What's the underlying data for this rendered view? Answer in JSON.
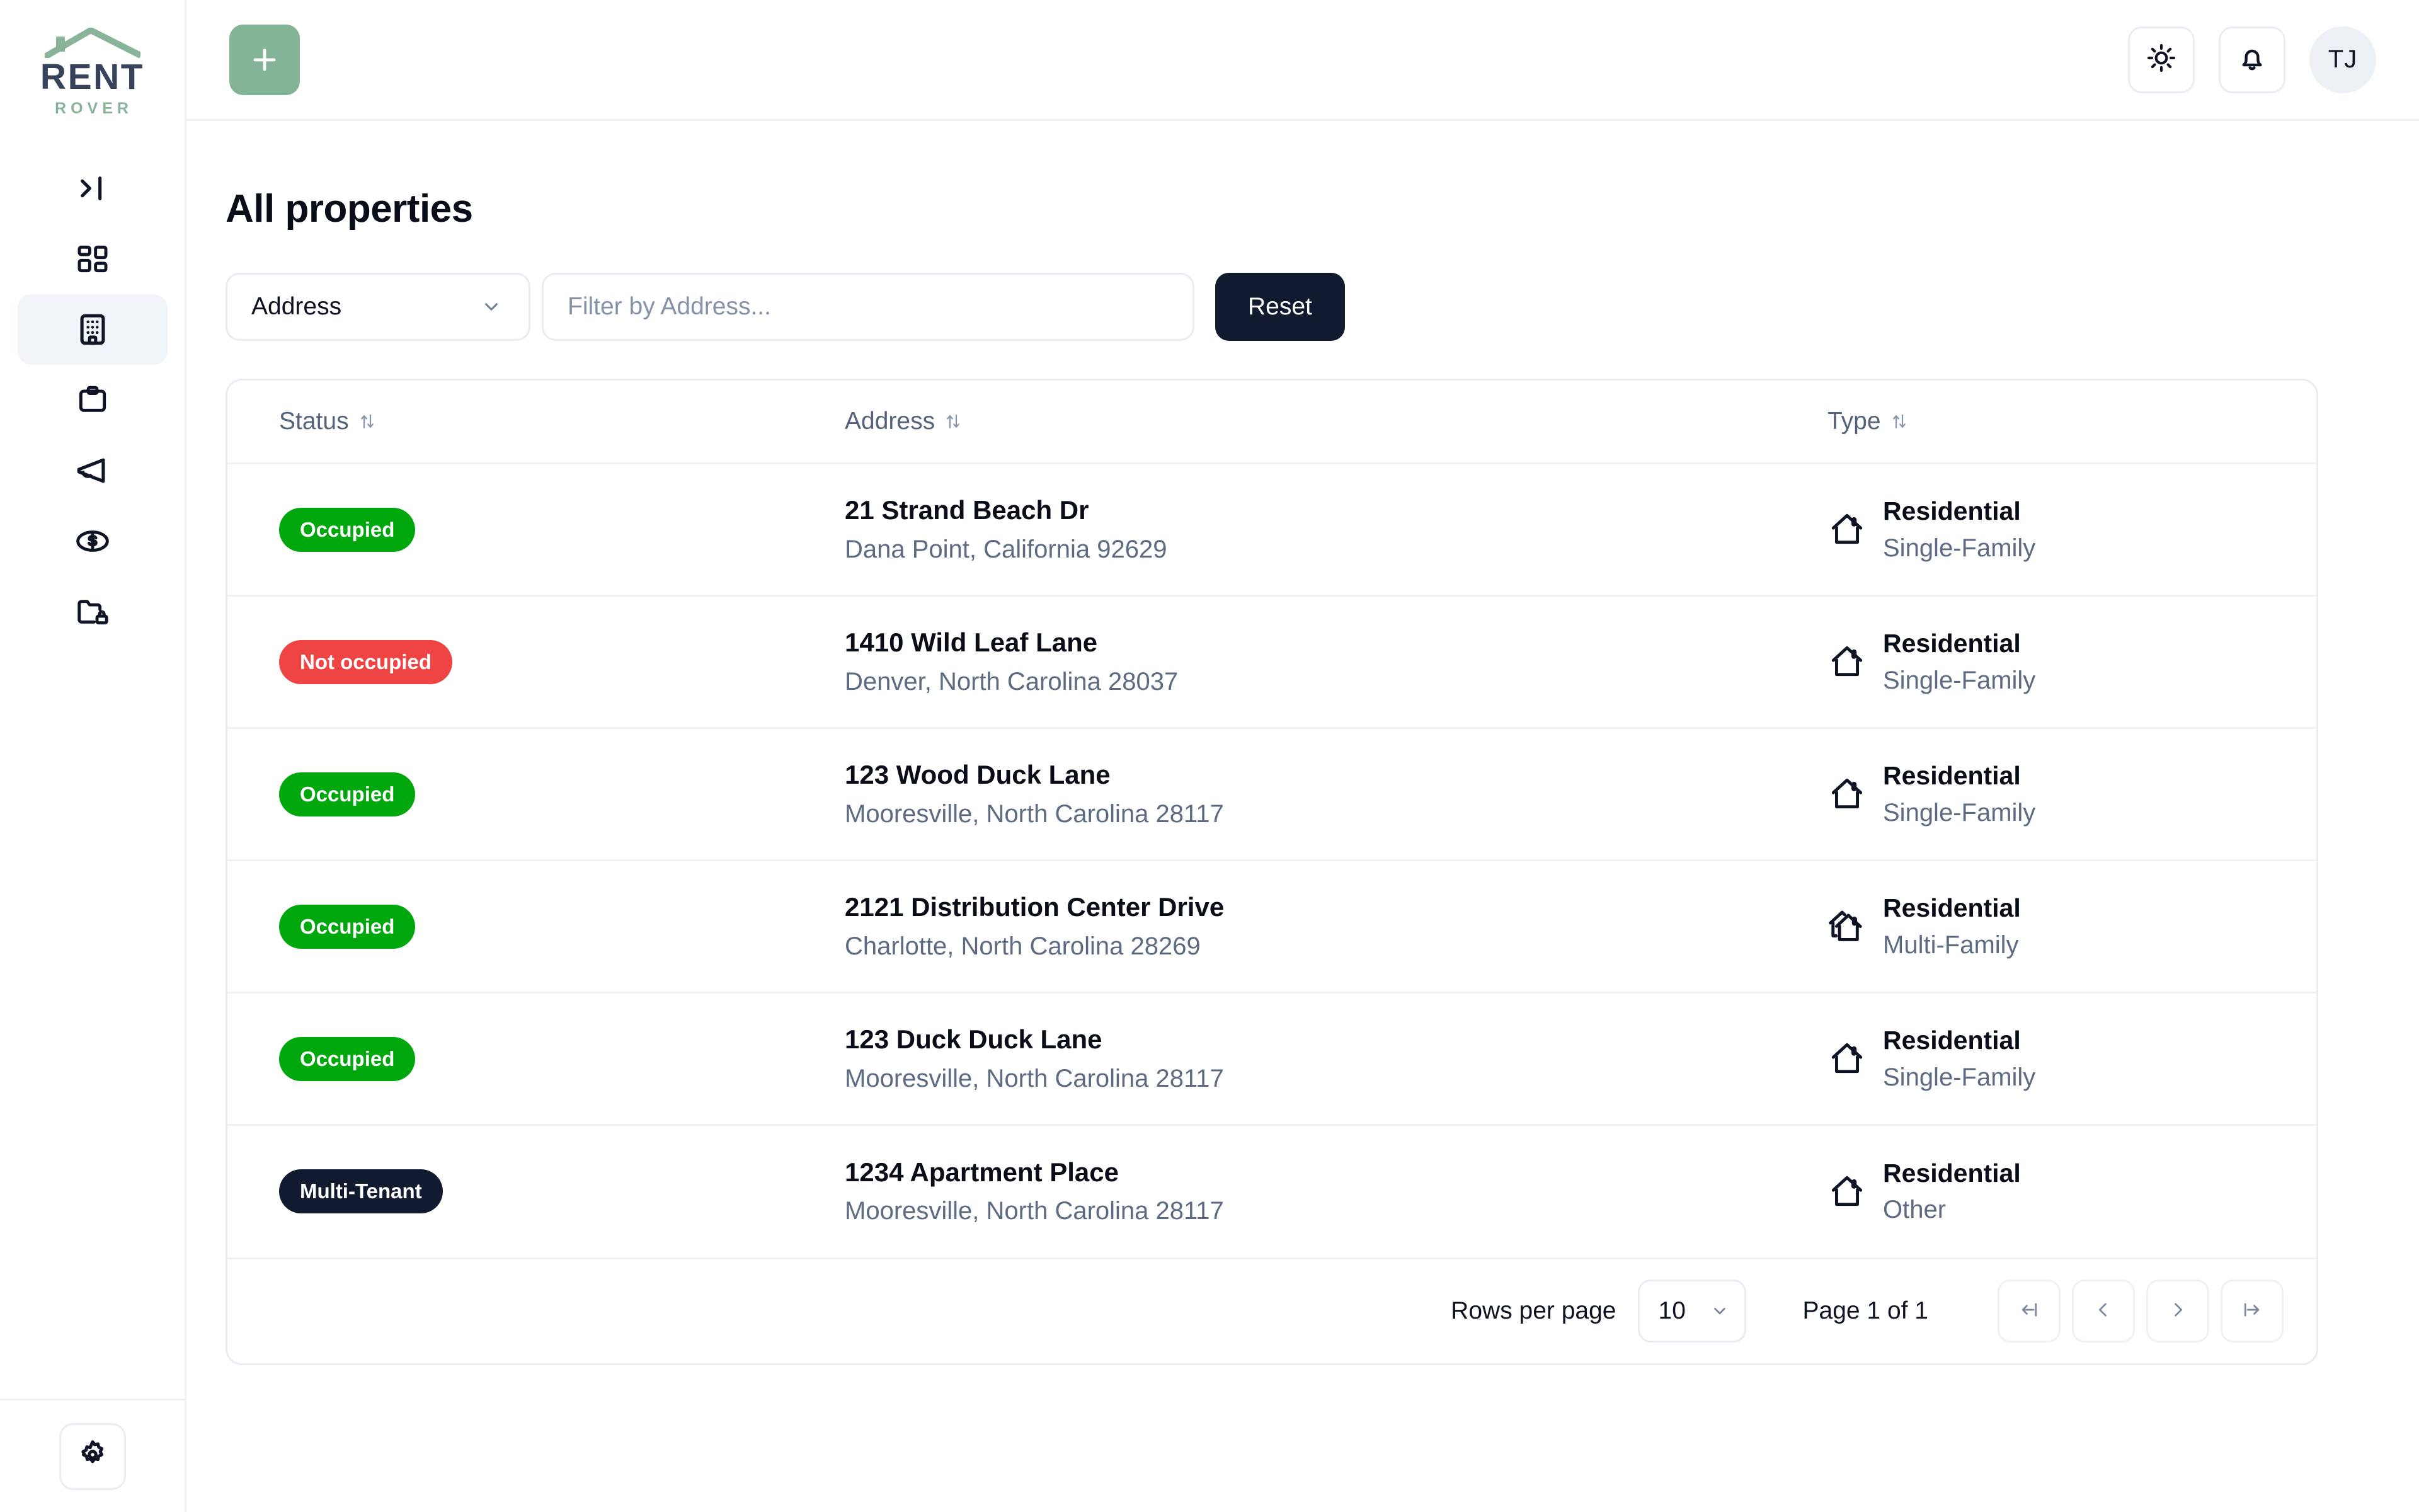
{
  "brand": {
    "name_top": "RENT",
    "name_bottom": "ROVER"
  },
  "sidebar": {
    "items": [
      {
        "icon": "panel-collapse-icon",
        "name": "collapse-sidebar",
        "active": false
      },
      {
        "icon": "dashboard-grid-icon",
        "name": "dashboard",
        "active": false
      },
      {
        "icon": "building-icon",
        "name": "properties",
        "active": true
      },
      {
        "icon": "clipboard-icon",
        "name": "tasks",
        "active": false
      },
      {
        "icon": "megaphone-icon",
        "name": "announcements",
        "active": false
      },
      {
        "icon": "dollar-coin-icon",
        "name": "payments",
        "active": false
      },
      {
        "icon": "folder-lock-icon",
        "name": "documents",
        "active": false
      }
    ],
    "settings_icon": "gear-icon"
  },
  "topbar": {
    "add_icon": "plus-icon",
    "theme_icon": "sun-icon",
    "notifications_icon": "bell-icon",
    "avatar_initials": "TJ"
  },
  "header": {
    "title": "All properties"
  },
  "filters": {
    "field_select_value": "Address",
    "field_select_icon": "chevron-down-icon",
    "text_placeholder": "Filter by Address...",
    "text_value": "",
    "reset_label": "Reset"
  },
  "table": {
    "columns": [
      {
        "label": "Status",
        "sort_icon": "sort-arrows-icon"
      },
      {
        "label": "Address",
        "sort_icon": "sort-arrows-icon"
      },
      {
        "label": "Type",
        "sort_icon": "sort-arrows-icon"
      }
    ],
    "rows": [
      {
        "status": "Occupied",
        "status_kind": "occupied",
        "address_line1": "21 Strand Beach Dr",
        "address_line2": "Dana Point, California 92629",
        "type_icon": "house-icon",
        "type_main": "Residential",
        "type_sub": "Single-Family"
      },
      {
        "status": "Not occupied",
        "status_kind": "not-occupied",
        "address_line1": "1410 Wild Leaf Lane",
        "address_line2": "Denver, North Carolina 28037",
        "type_icon": "house-icon",
        "type_main": "Residential",
        "type_sub": "Single-Family"
      },
      {
        "status": "Occupied",
        "status_kind": "occupied",
        "address_line1": "123 Wood Duck Lane",
        "address_line2": "Mooresville, North Carolina 28117",
        "type_icon": "house-icon",
        "type_main": "Residential",
        "type_sub": "Single-Family"
      },
      {
        "status": "Occupied",
        "status_kind": "occupied",
        "address_line1": "2121 Distribution Center Drive",
        "address_line2": "Charlotte, North Carolina 28269",
        "type_icon": "houses-icon",
        "type_main": "Residential",
        "type_sub": "Multi-Family"
      },
      {
        "status": "Occupied",
        "status_kind": "occupied",
        "address_line1": "123 Duck Duck Lane",
        "address_line2": "Mooresville, North Carolina 28117",
        "type_icon": "house-icon",
        "type_main": "Residential",
        "type_sub": "Single-Family"
      },
      {
        "status": "Multi-Tenant",
        "status_kind": "multi-tenant",
        "address_line1": "1234 Apartment Place",
        "address_line2": "Mooresville, North Carolina 28117",
        "type_icon": "house-icon",
        "type_main": "Residential",
        "type_sub": "Other"
      }
    ]
  },
  "pagination": {
    "rows_per_page_label": "Rows per page",
    "rows_per_page_value": "10",
    "rows_per_page_icon": "chevron-down-icon",
    "page_label": "Page 1 of 1",
    "first_icon": "first-page-icon",
    "prev_icon": "chevron-left-icon",
    "next_icon": "chevron-right-icon",
    "last_icon": "last-page-icon"
  },
  "colors": {
    "brand_green": "#84b497",
    "logo_green": "#89b499",
    "logo_navy": "#36435a",
    "occupied": "#00a80e",
    "not_occupied": "#ef4444",
    "multi_tenant": "#111a2e",
    "ink": "#090d18",
    "muted": "#5d6b82",
    "border": "#e9edf3"
  }
}
